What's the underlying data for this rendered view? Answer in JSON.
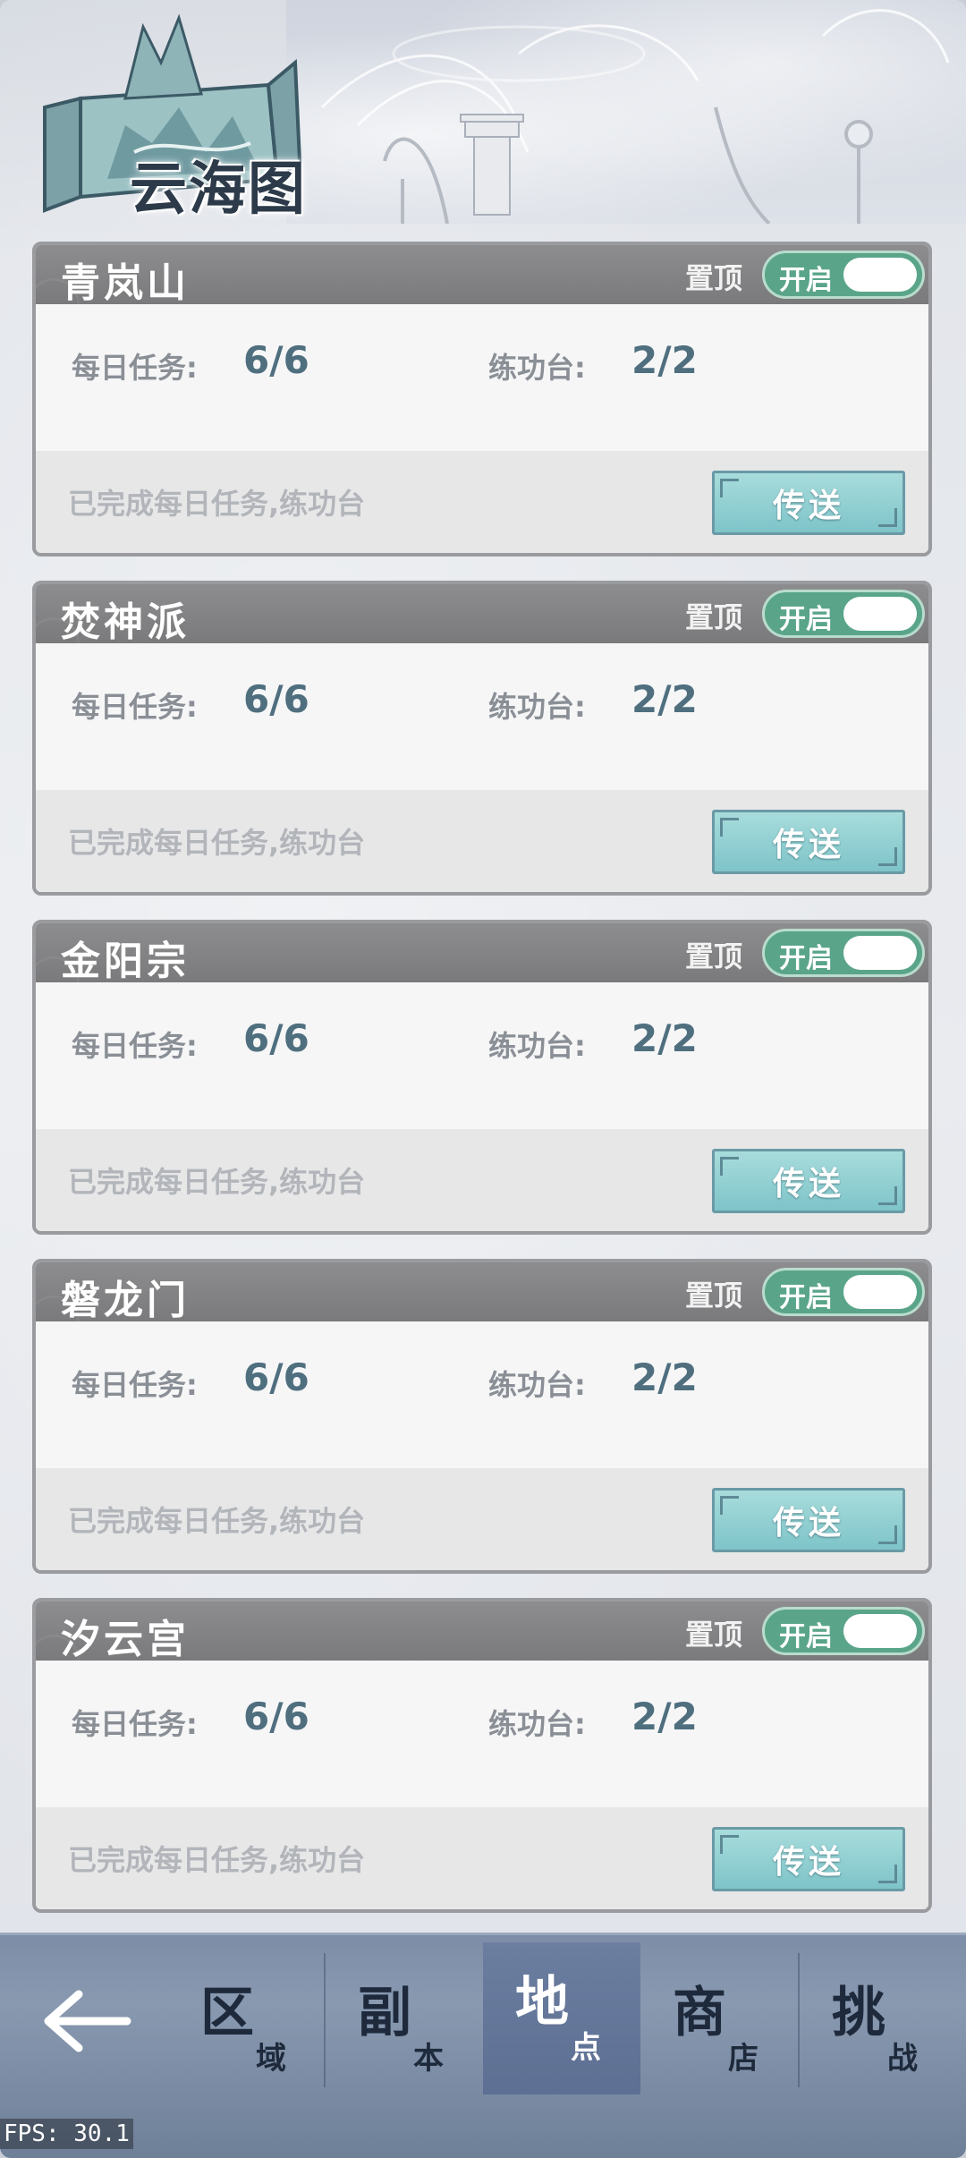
{
  "header": {
    "title": "云海图"
  },
  "cards": [
    {
      "name": "青岚山",
      "pin_label": "置顶",
      "toggle_label": "开启",
      "daily_label": "每日任务:",
      "daily_value": "6/6",
      "train_label": "练功台:",
      "train_value": "2/2",
      "status": "已完成每日任务,练功台",
      "send_label": "传送"
    },
    {
      "name": "焚神派",
      "pin_label": "置顶",
      "toggle_label": "开启",
      "daily_label": "每日任务:",
      "daily_value": "6/6",
      "train_label": "练功台:",
      "train_value": "2/2",
      "status": "已完成每日任务,练功台",
      "send_label": "传送"
    },
    {
      "name": "金阳宗",
      "pin_label": "置顶",
      "toggle_label": "开启",
      "daily_label": "每日任务:",
      "daily_value": "6/6",
      "train_label": "练功台:",
      "train_value": "2/2",
      "status": "已完成每日任务,练功台",
      "send_label": "传送"
    },
    {
      "name": "磐龙门",
      "pin_label": "置顶",
      "toggle_label": "开启",
      "daily_label": "每日任务:",
      "daily_value": "6/6",
      "train_label": "练功台:",
      "train_value": "2/2",
      "status": "已完成每日任务,练功台",
      "send_label": "传送"
    },
    {
      "name": "汐云宫",
      "pin_label": "置顶",
      "toggle_label": "开启",
      "daily_label": "每日任务:",
      "daily_value": "6/6",
      "train_label": "练功台:",
      "train_value": "2/2",
      "status": "已完成每日任务,练功台",
      "send_label": "传送"
    }
  ],
  "nav": {
    "back_icon": "back-arrow-icon",
    "items": [
      {
        "main": "区",
        "sub": "域",
        "active": false
      },
      {
        "main": "副",
        "sub": "本",
        "active": false
      },
      {
        "main": "地",
        "sub": "点",
        "active": true
      },
      {
        "main": "商",
        "sub": "店",
        "active": false
      },
      {
        "main": "挑",
        "sub": "战",
        "active": false
      }
    ]
  },
  "fps": "FPS: 30.1",
  "colors": {
    "toggle_on": "#5aa58a",
    "send_button": "#7ec4c9",
    "card_header": "#7a7a7c",
    "nav_bar": "#7d8da7"
  }
}
